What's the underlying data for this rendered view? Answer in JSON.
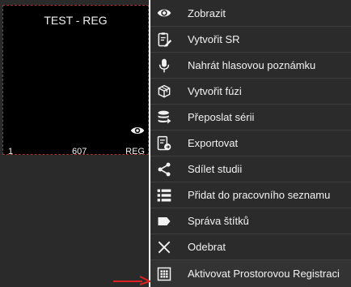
{
  "tile": {
    "title": "TEST - REG",
    "number": "1",
    "count": "607",
    "modality": "REG",
    "icon": "eye-icon"
  },
  "menu": {
    "items": [
      {
        "label": "Zobrazit",
        "icon": "eye-icon"
      },
      {
        "label": "Vytvořit SR",
        "icon": "report-edit-icon"
      },
      {
        "label": "Nahrát hlasovou poznámku",
        "icon": "microphone-icon"
      },
      {
        "label": "Vytvořit fúzi",
        "icon": "cube-fusion-icon"
      },
      {
        "label": "Přeposlat sérii",
        "icon": "database-forward-icon"
      },
      {
        "label": "Exportovat",
        "icon": "export-icon"
      },
      {
        "label": "Sdílet studii",
        "icon": "share-icon"
      },
      {
        "label": "Přidat do pracovního seznamu",
        "icon": "list-icon"
      },
      {
        "label": "Správa štítků",
        "icon": "tag-icon"
      },
      {
        "label": "Odebrat",
        "icon": "close-icon"
      },
      {
        "label": "Aktivovat Prostorovou Registraci",
        "icon": "grid-registration-icon"
      }
    ]
  },
  "colors": {
    "menu_bg": "#2b2b2b",
    "arrow": "#e02020",
    "tile_border": "#a83232"
  }
}
